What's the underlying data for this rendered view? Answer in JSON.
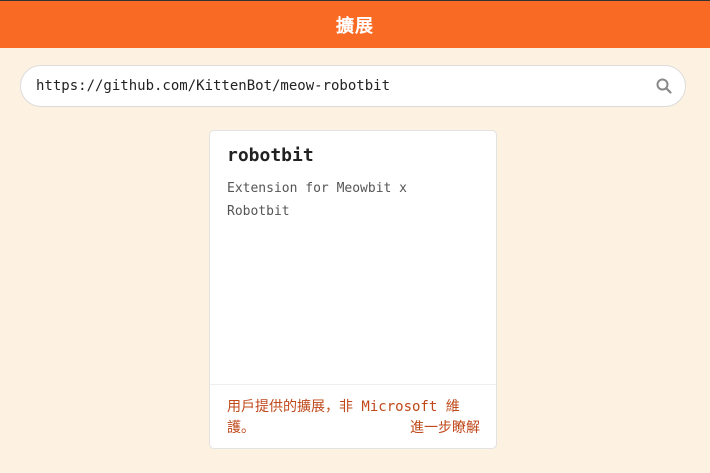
{
  "header": {
    "title": "擴展"
  },
  "search": {
    "value": "https://github.com/KittenBot/meow-robotbit",
    "icon": "search-icon"
  },
  "card": {
    "title": "robotbit",
    "description": "Extension for Meowbit x Robotbit",
    "footer_note": "用戶提供的擴展，非 Microsoft 維護。",
    "learn_more": "進一步瞭解"
  },
  "colors": {
    "header_bg": "#f96b25",
    "page_bg": "#fdf1e2",
    "link": "#c0481a"
  }
}
